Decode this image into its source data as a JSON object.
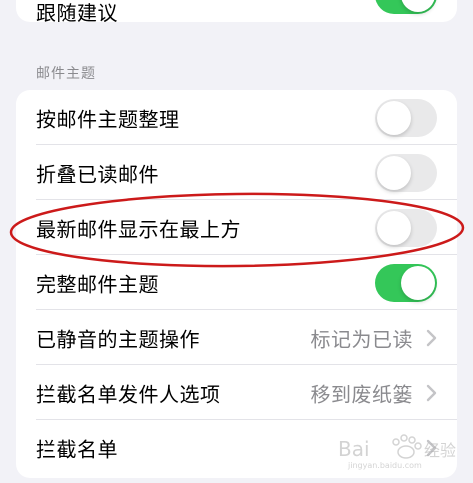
{
  "top_group": {
    "row": {
      "label": "跟随建议",
      "toggle_on": true
    }
  },
  "section": {
    "header": "邮件主题",
    "rows": [
      {
        "label": "按邮件主题整理",
        "type": "toggle",
        "toggle_on": false
      },
      {
        "label": "折叠已读邮件",
        "type": "toggle",
        "toggle_on": false
      },
      {
        "label": "最新邮件显示在最上方",
        "type": "toggle",
        "toggle_on": false
      },
      {
        "label": "完整邮件主题",
        "type": "toggle",
        "toggle_on": true
      },
      {
        "label": "已静音的主题操作",
        "type": "value",
        "value": "标记为已读"
      },
      {
        "label": "拦截名单发件人选项",
        "type": "value",
        "value": "移到废纸篓"
      },
      {
        "label": "拦截名单",
        "type": "nav"
      }
    ]
  },
  "colors": {
    "toggle_on": "#34c759",
    "toggle_off": "#e9e9ea",
    "annotation_ellipse": "#cc1a1a",
    "secondary_text": "#8a8a8e",
    "background": "#f2f2f7"
  },
  "icons": {
    "chevron": "chevron-right-icon"
  }
}
